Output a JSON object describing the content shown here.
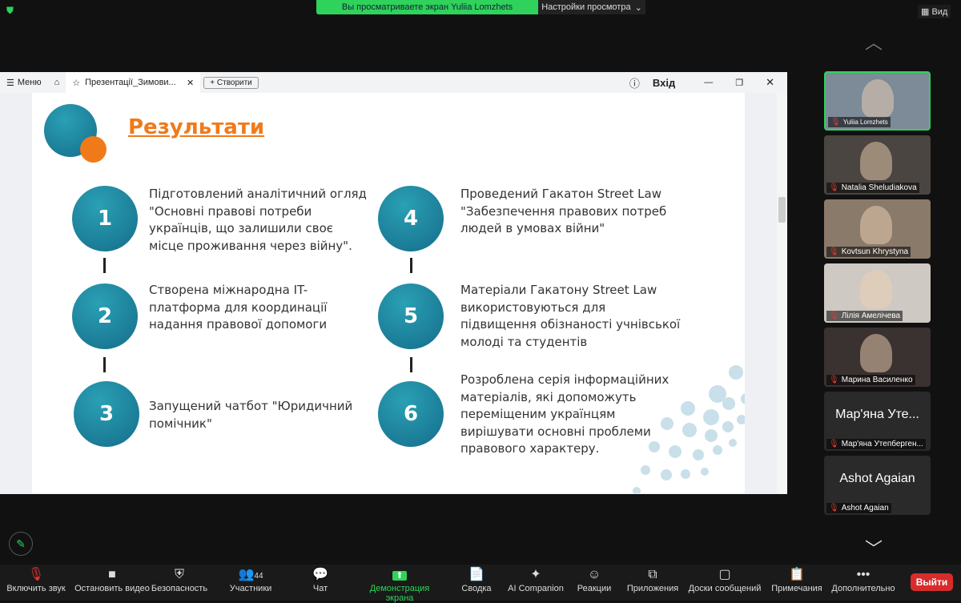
{
  "zoom": {
    "banner": "Вы просматриваете экран Yuliia Lomzhets",
    "view_settings": "Настройки просмотра",
    "view": "Вид",
    "leave": "Выйти",
    "participants_count": "44",
    "toolbar": [
      "Включить звук",
      "Остановить видео",
      "Безопасность",
      "Участники",
      "Чат",
      "Демонстрация экрана",
      "Сводка",
      "AI Companion",
      "Реакции",
      "Приложения",
      "Доски сообщений",
      "Примечания",
      "Дополнительно"
    ],
    "accent": "#2fd25a"
  },
  "browser": {
    "menu": "Меню",
    "tab_title": "Презентації_Зимови...",
    "new_button": "Створити",
    "login": "Вхід"
  },
  "slide": {
    "title": "Результати",
    "title_color": "#f07a1a",
    "circle_color": "#1a7f9a",
    "items": [
      {
        "num": "1",
        "text": "Підготовлений аналітичний огляд \"Основні правові потреби українців, що залишили своє місце проживання  через війну\"."
      },
      {
        "num": "2",
        "text": "Створена міжнародна IT-платформа для координації надання правової допомоги"
      },
      {
        "num": "3",
        "text": "Запущений чатбот \"Юридичний помічник\""
      },
      {
        "num": "4",
        "text": "Проведений Гакатон Street Law \"Забезпечення правових потреб людей в умовах війни\""
      },
      {
        "num": "5",
        "text": "Матеріали Гакатону Street Law використовуються для підвищення обізнаності учнівської молоді та студентів"
      },
      {
        "num": "6",
        "text": "Розроблена серія інформаційних матеріалів, які допоможуть переміщеним українцям вирішувати основні проблеми правового характеру."
      }
    ]
  },
  "participants": [
    {
      "name": "Yuliia Lomzhets",
      "active": true
    },
    {
      "name": "Natalia Sheludiakova"
    },
    {
      "name": "Kovtsun Khrystyna"
    },
    {
      "name": "Лілія Амелічева"
    },
    {
      "name": "Марина Василенко"
    },
    {
      "name": "Мар'яна Утепбергенова",
      "big": "Мар'яна Уте...",
      "short": "Мар'яна Утепберген..."
    },
    {
      "name": "Ashot Agaian",
      "big": "Ashot Agaian"
    }
  ]
}
